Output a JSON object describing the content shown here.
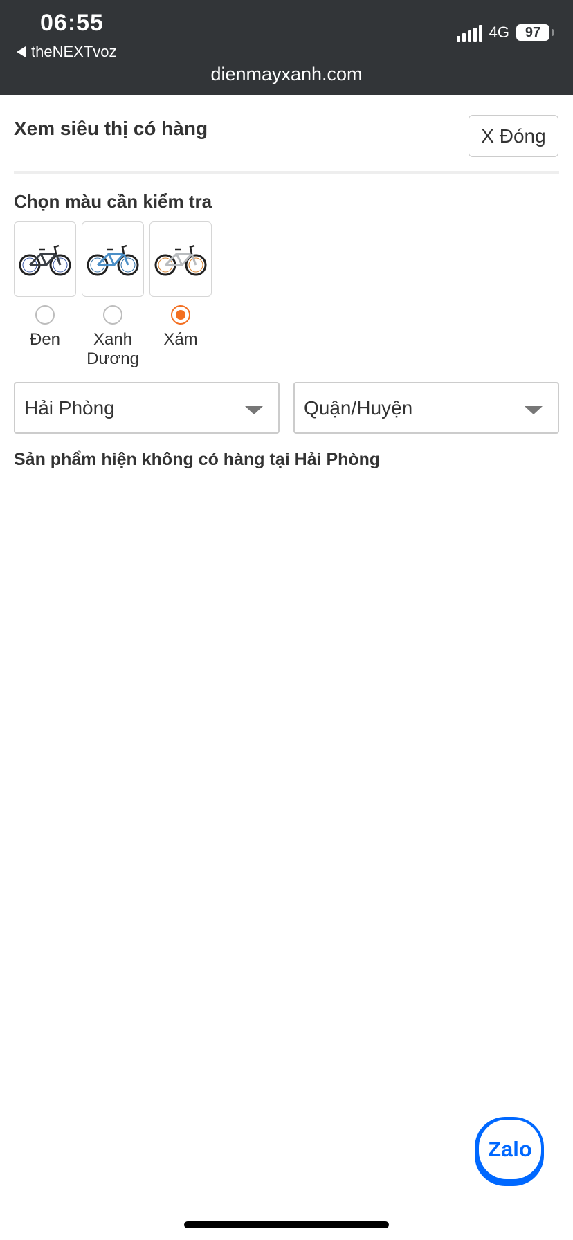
{
  "status_bar": {
    "time": "06:55",
    "back_label": "theNEXTvoz",
    "network": "4G",
    "battery": "97",
    "url": "dienmayxanh.com"
  },
  "dialog": {
    "title": "Xem siêu thị có hàng",
    "close_label": "X Đóng",
    "color_prompt": "Chọn màu cần kiểm tra",
    "colors": [
      {
        "name": "Đen",
        "selected": false,
        "frame_color": "#3a3f45",
        "accent": "#3d5ba8",
        "icon": "bicycle-black-icon"
      },
      {
        "name": "Xanh Dương",
        "selected": false,
        "frame_color": "#4b8fc7",
        "accent": "#2f6fa8",
        "icon": "bicycle-blue-icon"
      },
      {
        "name": "Xám",
        "selected": true,
        "frame_color": "#b9bcbf",
        "accent": "#d9822b",
        "icon": "bicycle-gray-icon"
      }
    ],
    "province_select": "Hải Phòng",
    "district_select": "Quận/Huyện",
    "availability_notice": "Sản phẩm hiện không có hàng tại Hải Phòng"
  },
  "chat_widget": {
    "label": "Zalo"
  },
  "colors": {
    "accent": "#f36f21",
    "zalo": "#0068ff",
    "statusbar": "#323538"
  }
}
